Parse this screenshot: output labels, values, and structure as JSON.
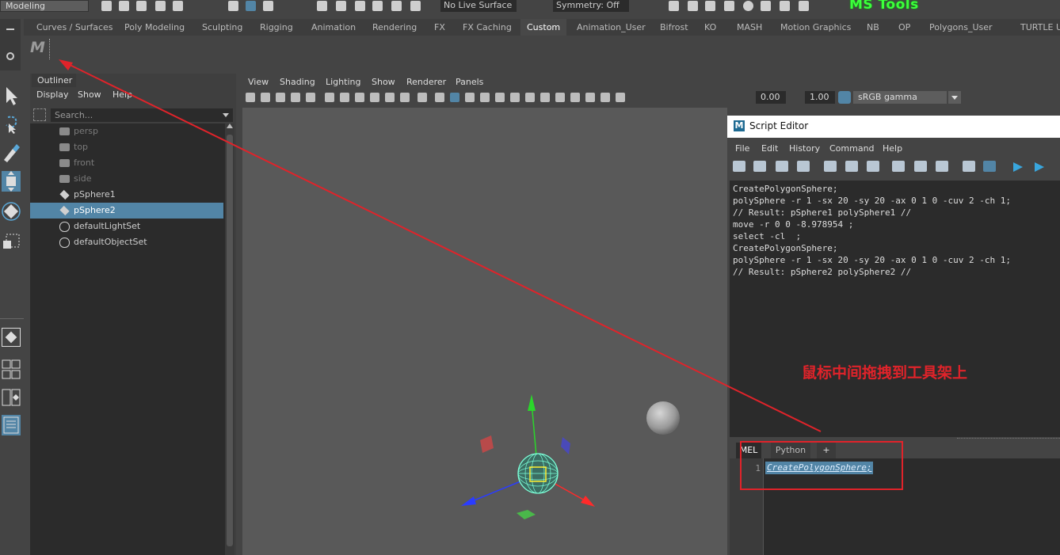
{
  "toolbar": {
    "mode": "Modeling",
    "live_surface": "No Live Surface",
    "symmetry": "Symmetry: Off",
    "brand": "MS Tools"
  },
  "shelf": {
    "tabs": [
      "Curves / Surfaces",
      "Poly Modeling",
      "Sculpting",
      "Rigging",
      "Animation",
      "Rendering",
      "FX",
      "FX Caching",
      "Custom",
      "Animation_User",
      "Bifrost",
      "KO",
      "MASH",
      "Motion Graphics",
      "NB",
      "OP",
      "Polygons_User",
      "TURTLE",
      "UA"
    ],
    "active_tab": "Custom",
    "logo_text": "M"
  },
  "outliner": {
    "title": "Outliner",
    "menu": [
      "Display",
      "Show",
      "Help"
    ],
    "search_placeholder": "Search...",
    "items": [
      {
        "label": "persp",
        "icon": "camera-icon",
        "dim": true
      },
      {
        "label": "top",
        "icon": "camera-icon",
        "dim": true
      },
      {
        "label": "front",
        "icon": "camera-icon",
        "dim": true
      },
      {
        "label": "side",
        "icon": "camera-icon",
        "dim": true
      },
      {
        "label": "pSphere1",
        "icon": "mesh-icon",
        "dim": false
      },
      {
        "label": "pSphere2",
        "icon": "mesh-icon",
        "dim": false,
        "selected": true
      },
      {
        "label": "defaultLightSet",
        "icon": "set-icon",
        "dim": false
      },
      {
        "label": "defaultObjectSet",
        "icon": "set-icon",
        "dim": false
      }
    ]
  },
  "viewport": {
    "menu": [
      "View",
      "Shading",
      "Lighting",
      "Show",
      "Renderer",
      "Panels"
    ],
    "exposure": "0.00",
    "gamma": "1.00",
    "color_space": "sRGB gamma"
  },
  "script_editor": {
    "title": "Script Editor",
    "menu": [
      "File",
      "Edit",
      "History",
      "Command",
      "Help"
    ],
    "history": [
      "CreatePolygonSphere;",
      "polySphere -r 1 -sx 20 -sy 20 -ax 0 1 0 -cuv 2 -ch 1;",
      "// Result: pSphere1 polySphere1 //",
      "move -r 0 0 -8.978954 ;",
      "select -cl  ;",
      "CreatePolygonSphere;",
      "polySphere -r 1 -sx 20 -sy 20 -ax 0 1 0 -cuv 2 -ch 1;",
      "// Result: pSphere2 polySphere2 //"
    ],
    "tabs": [
      "MEL",
      "Python",
      "+"
    ],
    "active_tab": "MEL",
    "input_line_number": "1",
    "input_text": "CreatePolygonSphere;"
  },
  "annotation": {
    "note": "鼠标中间拖拽到工具架上",
    "color": "#e0232a"
  }
}
